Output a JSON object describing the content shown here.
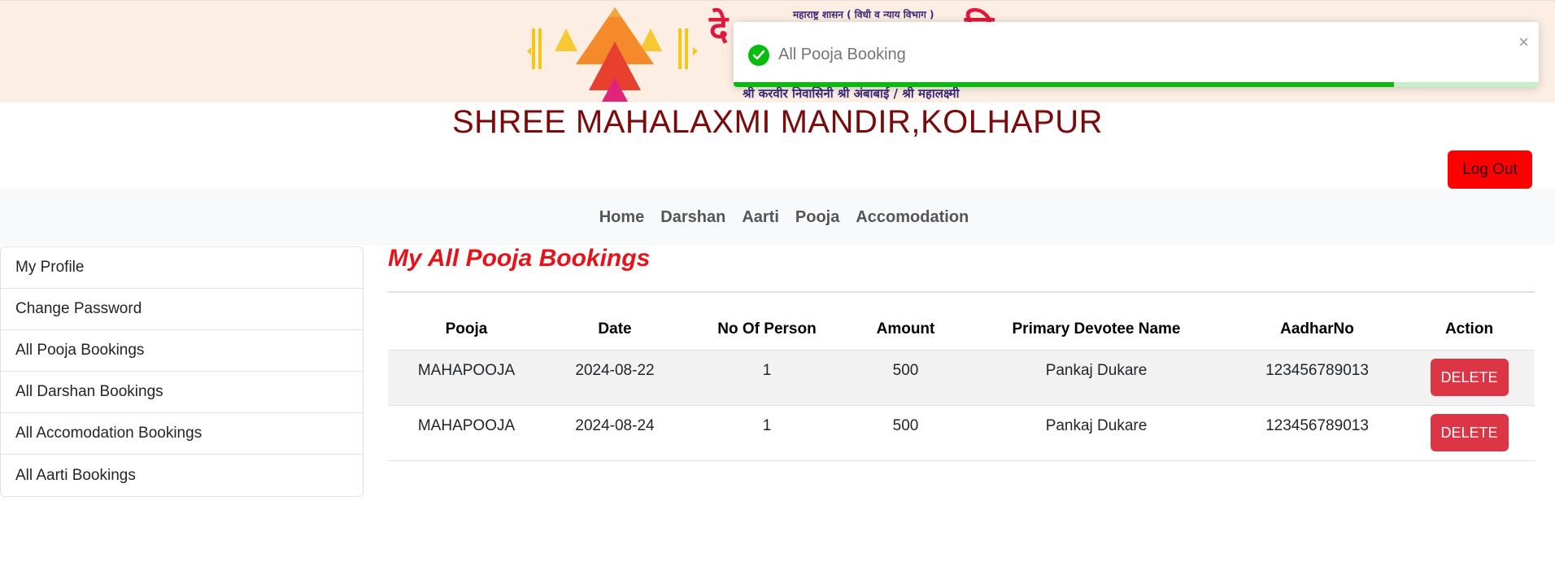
{
  "banner": {
    "top_line": "महाराष्ट्र शासन ( विधी व न्याय विभाग )",
    "big_text_left": "दे",
    "big_text_right": "वि",
    "bottom_line": "श्री करवीर निवासिनी श्री अंबाबाई / श्री महालक्ष्मी",
    "logo_icon": "temple-lamp-logo"
  },
  "toast": {
    "message": "All Pooja Booking",
    "icon": "check-circle-icon",
    "close_glyph": "×",
    "progress": 0.82,
    "color": "#07bc0c"
  },
  "site_title": "SHREE MAHALAXMI MANDIR,KOLHAPUR",
  "logout_label": "Log Out",
  "nav": [
    "Home",
    "Darshan",
    "Aarti",
    "Pooja",
    "Accomodation"
  ],
  "sidebar": [
    "My Profile",
    "Change Password",
    "All Pooja Bookings",
    "All Darshan Bookings",
    "All Accomodation Bookings",
    "All Aarti Bookings"
  ],
  "page_heading": "My All Pooja Bookings",
  "table": {
    "headers": [
      "Pooja",
      "Date",
      "No Of Person",
      "Amount",
      "Primary Devotee Name",
      "AadharNo",
      "Action"
    ],
    "rows": [
      [
        "MAHAPOOJA",
        "2024-08-22",
        "1",
        "500",
        "Pankaj Dukare",
        "123456789013",
        "DELETE"
      ],
      [
        "MAHAPOOJA",
        "2024-08-24",
        "1",
        "500",
        "Pankaj Dukare",
        "123456789013",
        "DELETE"
      ]
    ]
  },
  "colors": {
    "banner_bg": "#fdeee3",
    "title": "#7b0a0a",
    "heading": "#e4141b",
    "logout": "#ff0000",
    "delete": "#dc3545"
  }
}
